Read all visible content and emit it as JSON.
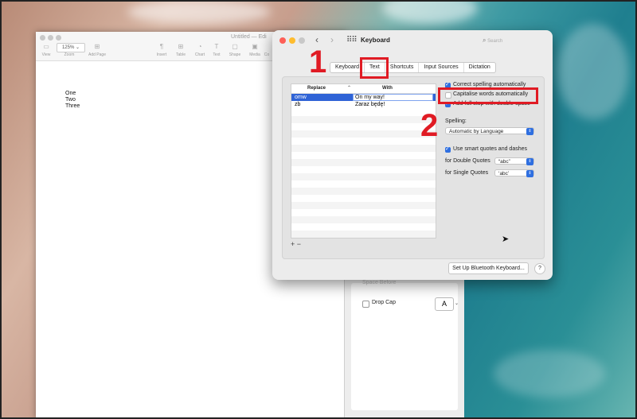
{
  "pages": {
    "title": "Untitled — Edi",
    "zoom": "125%",
    "toolbar": [
      "View",
      "Zoom",
      "Add Page",
      "Insert",
      "Table",
      "Chart",
      "Text",
      "Shape",
      "Media",
      "Co"
    ],
    "lines": [
      "One",
      "Two",
      "Three"
    ]
  },
  "inspector": {
    "faded_label": "Space Before",
    "drop_cap_label": "Drop Cap",
    "drop_cap_style": "A"
  },
  "keyboard": {
    "title": "Keyboard",
    "search_placeholder": "Search",
    "tabs": [
      "Keyboard",
      "Text",
      "Shortcuts",
      "Input Sources",
      "Dictation"
    ],
    "selected_tab": "Text",
    "table": {
      "headers": [
        "Replace",
        "With"
      ],
      "rows": [
        {
          "replace": "omw",
          "with": "On my way!"
        },
        {
          "replace": "zb",
          "with": "Zaraz będę!"
        }
      ]
    },
    "add_remove": "+  −",
    "options": {
      "correct_spelling": "Correct spelling automatically",
      "capitalise": "Capitalise words automatically",
      "full_stop": "Add full stop with double-space",
      "spelling_label": "Spelling:",
      "spelling_value": "Automatic by Language",
      "smart_quotes": "Use smart quotes and dashes",
      "double_label": "for Double Quotes",
      "double_value": "“abc”",
      "single_label": "for Single Quotes",
      "single_value": "‘abc’"
    },
    "bluetooth_button": "Set Up Bluetooth Keyboard...",
    "help_button": "?"
  },
  "annotations": {
    "step1": "1",
    "step2": "2",
    "color": "#e01b24"
  }
}
